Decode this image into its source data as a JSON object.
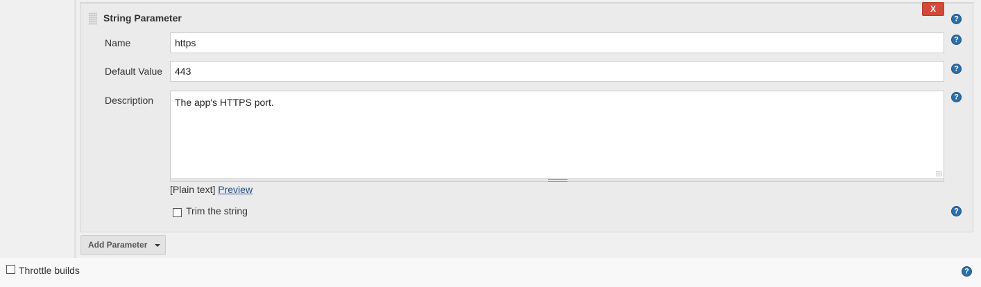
{
  "string_parameter": {
    "title": "String Parameter",
    "delete_label": "X",
    "name_label": "Name",
    "name_value": "https",
    "default_label": "Default Value",
    "default_value": "443",
    "description_label": "Description",
    "description_value": "The app's HTTPS port.",
    "format_prefix": "[Plain text]",
    "preview_link": "Preview",
    "trim_label": "Trim the string",
    "trim_checked": false
  },
  "add_parameter": {
    "label": "Add Parameter"
  },
  "throttle": {
    "label": "Throttle builds",
    "checked": false
  },
  "colors": {
    "delete_button": "#d24939",
    "help_icon": "#2c6ea8",
    "link": "#204a87"
  },
  "icons": {
    "help": "help-icon",
    "dropdown": "chevron-down-icon"
  }
}
